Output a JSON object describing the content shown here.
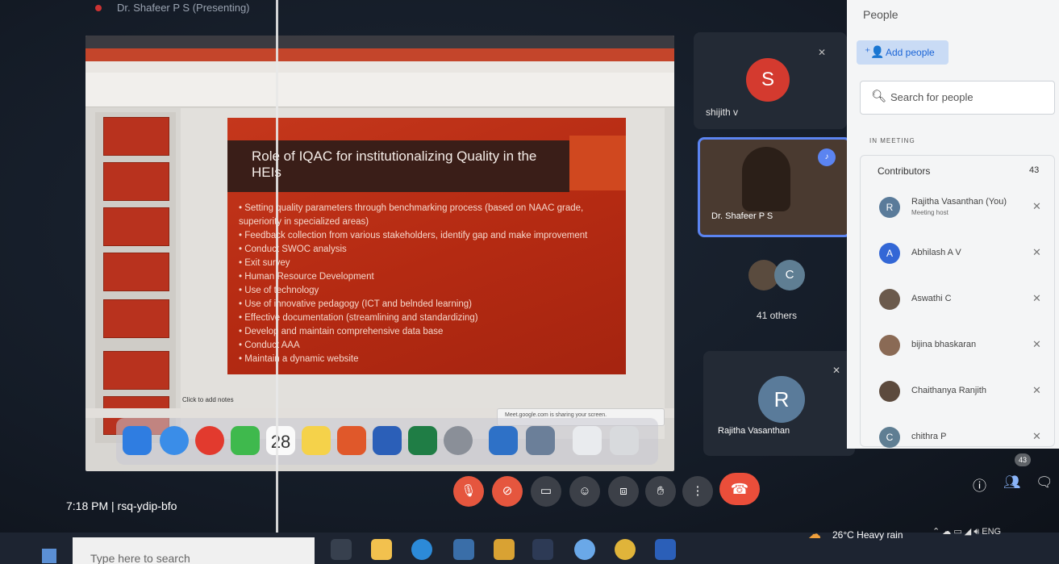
{
  "presenting_label": "Dr. Shafeer P S (Presenting)",
  "ppt": {
    "slide_title": "Role of IQAC for institutionalizing Quality in the HEIs",
    "bullets": [
      "Setting quality parameters through benchmarking process (based on NAAC grade, superiority in specialized areas)",
      "Feedback collection from various stakeholders, identify gap and make improvement",
      "Conduct SWOC analysis",
      "Exit survey",
      "Human Resource Development",
      "Use of technology",
      "Use of innovative pedagogy (ICT and belnded learning)",
      "Effective documentation (streamlining and standardizing)",
      "Develop and maintain comprehensive data base",
      "Conduct AAA",
      "Maintain a dynamic website"
    ],
    "notes_placeholder": "Click to add notes",
    "toast": "Meet.google.com is sharing your screen.",
    "calendar_day": "28"
  },
  "tiles": {
    "shijith": {
      "initial": "S",
      "name": "shijith v"
    },
    "shafeer": {
      "name": "Dr. Shafeer P S"
    },
    "others": {
      "initial": "C",
      "label": "41 others"
    },
    "rajitha": {
      "initial": "R",
      "name": "Rajitha Vasanthan"
    }
  },
  "people_panel": {
    "title": "People",
    "add_people": "Add people",
    "search_placeholder": "Search for people",
    "section": "IN MEETING",
    "contributors_label": "Contributors",
    "contributors_count": "43",
    "participants": [
      {
        "initial": "R",
        "name": "Rajitha Vasanthan (You)",
        "sub": "Meeting host",
        "color": "#5a7b9a"
      },
      {
        "initial": "A",
        "name": "Abhilash A V",
        "sub": "",
        "color": "#3367d6"
      },
      {
        "initial": "",
        "name": "Aswathi C",
        "sub": "",
        "color": "#6b5a4c"
      },
      {
        "initial": "",
        "name": "bijina bhaskaran",
        "sub": "",
        "color": "#8a6a55"
      },
      {
        "initial": "",
        "name": "Chaithanya Ranjith",
        "sub": "",
        "color": "#5c4a3d"
      },
      {
        "initial": "C",
        "name": "chithra P",
        "sub": "",
        "color": "#5f7e93"
      }
    ]
  },
  "meet_bar": {
    "time_code": "7:18 PM  |  rsq-ydip-bfo",
    "people_badge": "43"
  },
  "taskbar": {
    "search_placeholder": "Type here to search",
    "weather": "26°C  Heavy rain",
    "tray": "ENG"
  },
  "colors": {
    "accent_red": "#ea4e3a",
    "meet_blue": "#5b84f1",
    "slide_red": "#c5371c"
  }
}
